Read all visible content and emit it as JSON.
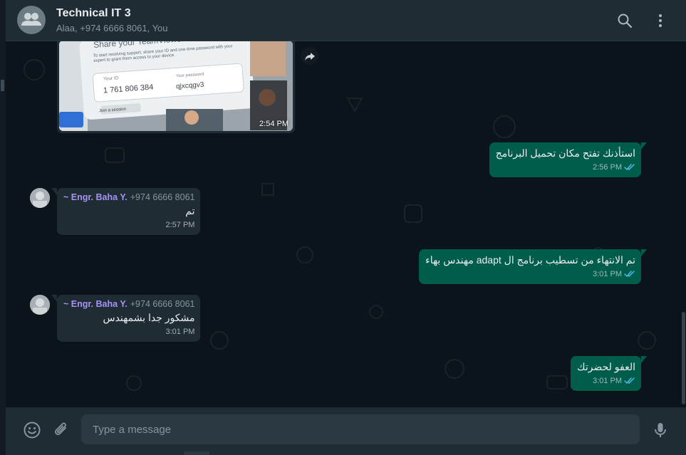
{
  "header": {
    "title": "Technical IT 3",
    "subtitle": "Alaa, +974 6666 8061, You",
    "icons": [
      "group-icon",
      "search-icon",
      "menu-icon"
    ]
  },
  "image_message": {
    "time": "2:54 PM",
    "image_text": {
      "heading": "Share your TeamViewer ID",
      "instructions": "To start receiving support, share your ID and one-time password with your expert to grant them access to your device.",
      "id_label": "Your ID",
      "id_value": "1 761 806 384",
      "password_label": "Your password",
      "password_value": "qjxcqgv3",
      "button": "Join a session"
    }
  },
  "messages": [
    {
      "direction": "out",
      "text": "استأذنك تفتح مكان تحميل البرنامج",
      "time": "2:56 PM",
      "read": true
    },
    {
      "direction": "in",
      "sender": "~ Engr. Baha Y.",
      "phone": "+974 6666 8061",
      "text": "تم",
      "time": "2:57 PM"
    },
    {
      "direction": "out",
      "text": "تم الانتهاء من تسطيب برنامج ال adapt مهندس بهاء",
      "time": "3:01 PM",
      "read": true
    },
    {
      "direction": "in",
      "sender": "~ Engr. Baha Y.",
      "phone": "+974 6666 8061",
      "text": "مشكور جدا بشمهندس",
      "time": "3:01 PM"
    },
    {
      "direction": "out",
      "text": "العفو لحضرتك",
      "time": "3:01 PM",
      "read": true
    }
  ],
  "footer": {
    "placeholder": "Type a message",
    "icons": [
      "emoji-icon",
      "attach-icon",
      "mic-icon"
    ]
  },
  "colors": {
    "outgoing_bubble": "#005c4b",
    "incoming_bubble": "#202c33",
    "sender_name": "#a791f4",
    "read_ticks": "#53bdeb",
    "background": "#0b141a"
  }
}
